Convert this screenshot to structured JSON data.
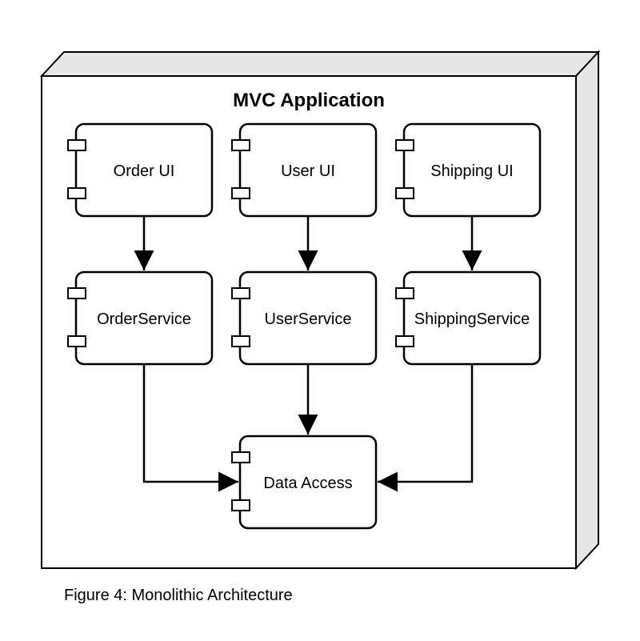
{
  "title": "MVC Application",
  "caption": "Figure 4: Monolithic Architecture",
  "components": {
    "ui": [
      {
        "label": "Order UI"
      },
      {
        "label": "User UI"
      },
      {
        "label": "Shipping UI"
      }
    ],
    "services": [
      {
        "label": "OrderService"
      },
      {
        "label": "UserService"
      },
      {
        "label": "ShippingService"
      }
    ],
    "data": {
      "label": "Data Access"
    }
  },
  "arrows": [
    {
      "from": "Order UI",
      "to": "OrderService"
    },
    {
      "from": "User UI",
      "to": "UserService"
    },
    {
      "from": "Shipping UI",
      "to": "ShippingService"
    },
    {
      "from": "OrderService",
      "to": "Data Access"
    },
    {
      "from": "UserService",
      "to": "Data Access"
    },
    {
      "from": "ShippingService",
      "to": "Data Access"
    }
  ],
  "colors": {
    "stroke": "#000000",
    "fill": "#ffffff",
    "shade": "#e6e6e6"
  }
}
